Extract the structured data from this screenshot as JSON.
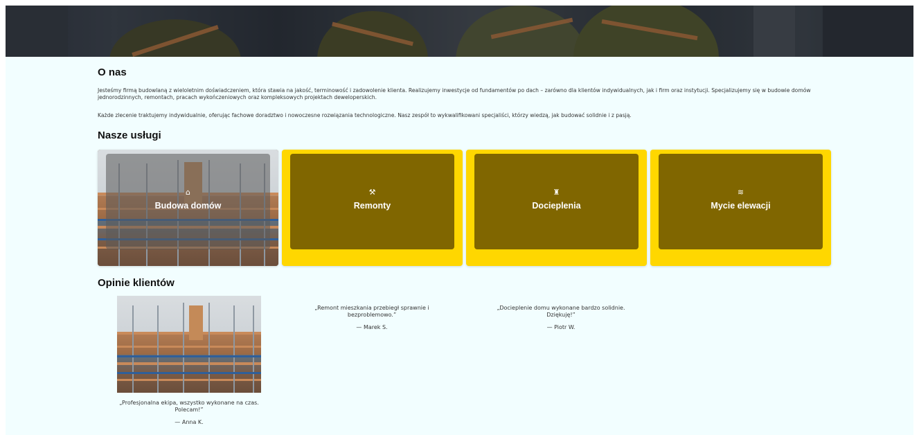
{
  "about": {
    "title": "O nas",
    "paragraph_1": "Jesteśmy firmą budowlaną z wieloletnim doświadczeniem, która stawia na jakość, terminowość i zadowolenie klienta. Realizujemy inwestycje od fundamentów po dach – zarówno dla klientów indywidualnych, jak i firm oraz instytucji. Specjalizujemy się w budowie domów jednorodzinnych, remontach, pracach wykończeniowych oraz kompleksowych projektach deweloperskich.",
    "paragraph_2": "Każde zlecenie traktujemy indywidualnie, oferując fachowe doradztwo i nowoczesne rozwiązania technologiczne. Nasz zespół to wykwalifikowani specjaliści, którzy wiedzą, jak budować solidnie i z pasją."
  },
  "services": {
    "title": "Nasze usługi",
    "items": [
      {
        "label": "Budowa domów",
        "icon": "home-icon",
        "glyph": "⌂"
      },
      {
        "label": "Remonty",
        "icon": "paint-roller-icon",
        "glyph": "⚒"
      },
      {
        "label": "Docieplenia",
        "icon": "brush-icon",
        "glyph": "♜"
      },
      {
        "label": "Mycie elewacji",
        "icon": "water-icon",
        "glyph": "≋"
      }
    ]
  },
  "reviews": {
    "title": "Opinie klientów",
    "items": [
      {
        "quote": "„Profesjonalna ekipa, wszystko wykonane na czas. Polecam!”",
        "author": "— Anna K."
      },
      {
        "quote": "„Remont mieszkania przebiegł sprawnie i bezproblemowo.”",
        "author": "— Marek S."
      },
      {
        "quote": "„Docieplenie domu wykonane bardzo solidnie. Dziękuję!”",
        "author": "— Piotr W."
      }
    ]
  },
  "colors": {
    "page_background": "#f2feff",
    "card_yellow": "#ffd700",
    "card_inner": "#806600"
  }
}
